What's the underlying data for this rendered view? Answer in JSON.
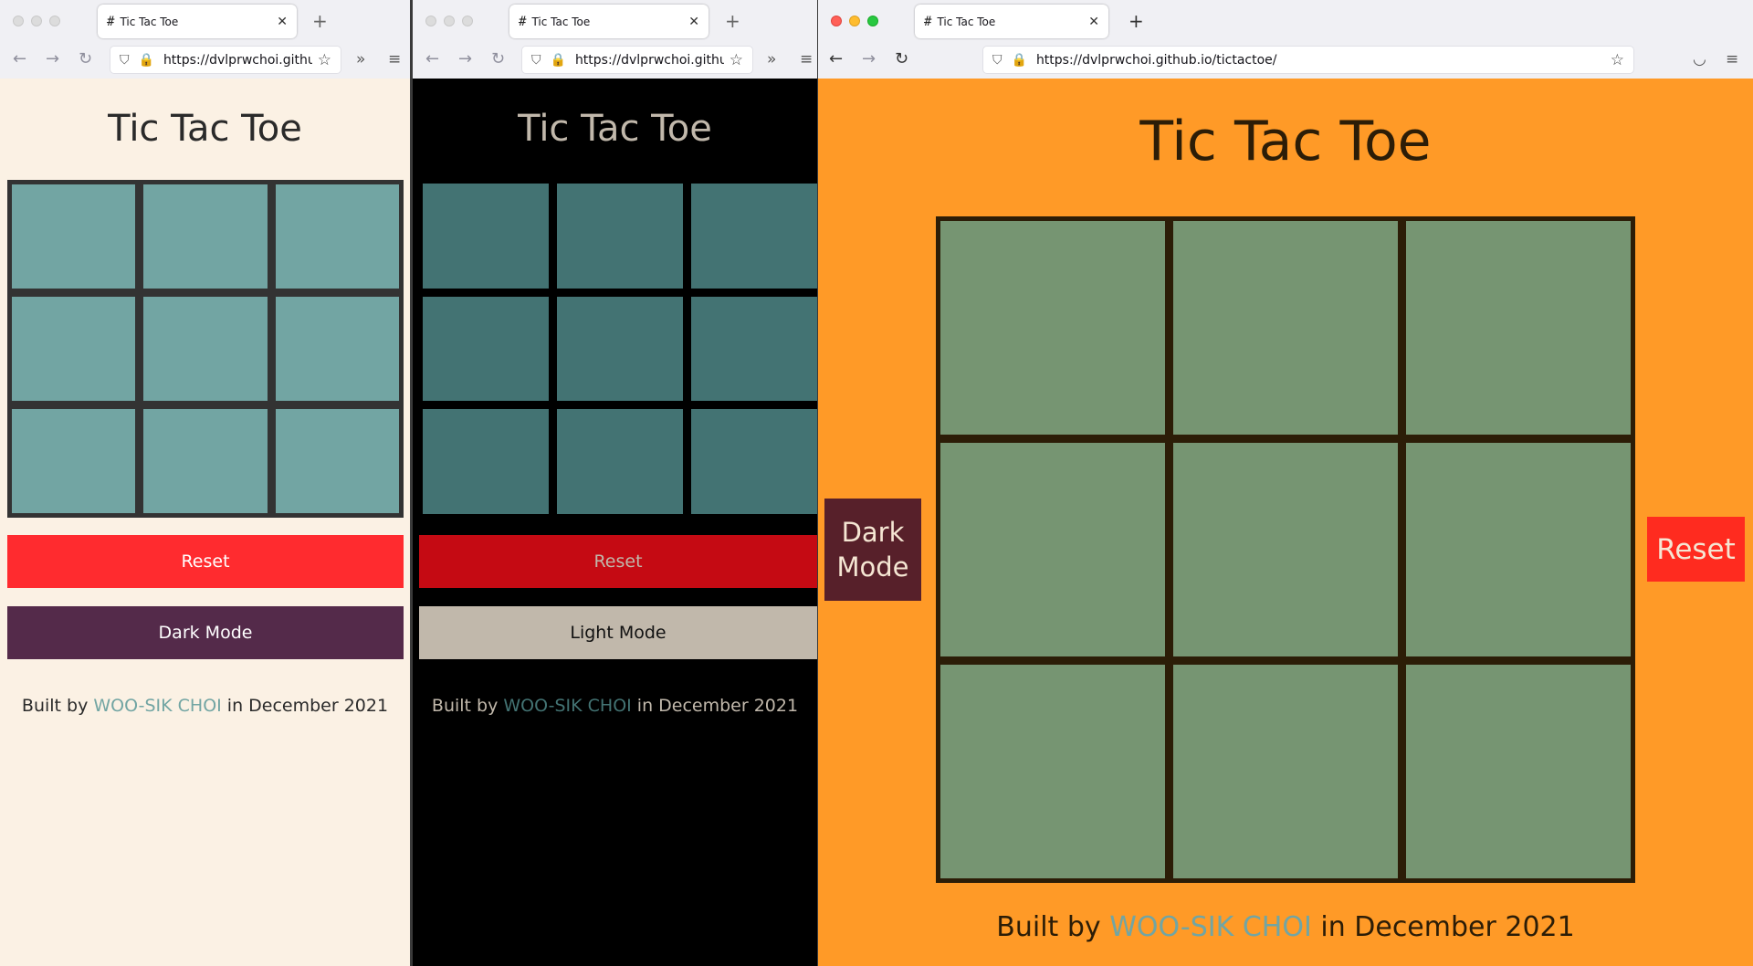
{
  "colors": {
    "light_bg": "#fbf1e4",
    "light_cell": "#72a5a3",
    "light_board": "#333333",
    "light_reset": "#ff2b2f",
    "light_mode_btn": "#542a4a",
    "dark_bg": "#000000",
    "dark_cell": "#437373",
    "dark_reset": "#c50a13",
    "dark_mode_btn": "#c1b8ab",
    "orange_bg": "#ff9a27",
    "orange_cell": "#769572",
    "orange_board": "#2c1d07",
    "orange_dark_btn": "#57202a",
    "orange_reset": "#ff2b1f",
    "link": "#72a5a3"
  },
  "windows": [
    {
      "tab_title": "Tic Tac Toe",
      "url": "https://dvlprwchoi.github.io/tictactoe/",
      "page_title": "Tic Tac Toe",
      "reset_label": "Reset",
      "mode_label": "Dark Mode",
      "footer_prefix": "Built by",
      "author": "WOO-SIK CHOI",
      "footer_suffix": "in December 2021"
    },
    {
      "tab_title": "Tic Tac Toe",
      "url": "https://dvlprwchoi.github.io/tictactoe/",
      "page_title": "Tic Tac Toe",
      "reset_label": "Reset",
      "mode_label": "Light Mode",
      "footer_prefix": "Built by",
      "author": "WOO-SIK CHOI",
      "footer_suffix": "in December 2021"
    },
    {
      "tab_title": "Tic Tac Toe",
      "url": "https://dvlprwchoi.github.io/tictactoe/",
      "page_title": "Tic Tac Toe",
      "reset_label": "Reset",
      "mode_label": "Dark Mode",
      "footer_prefix": "Built by",
      "author": "WOO-SIK CHOI",
      "footer_suffix": "in December 2021"
    }
  ]
}
